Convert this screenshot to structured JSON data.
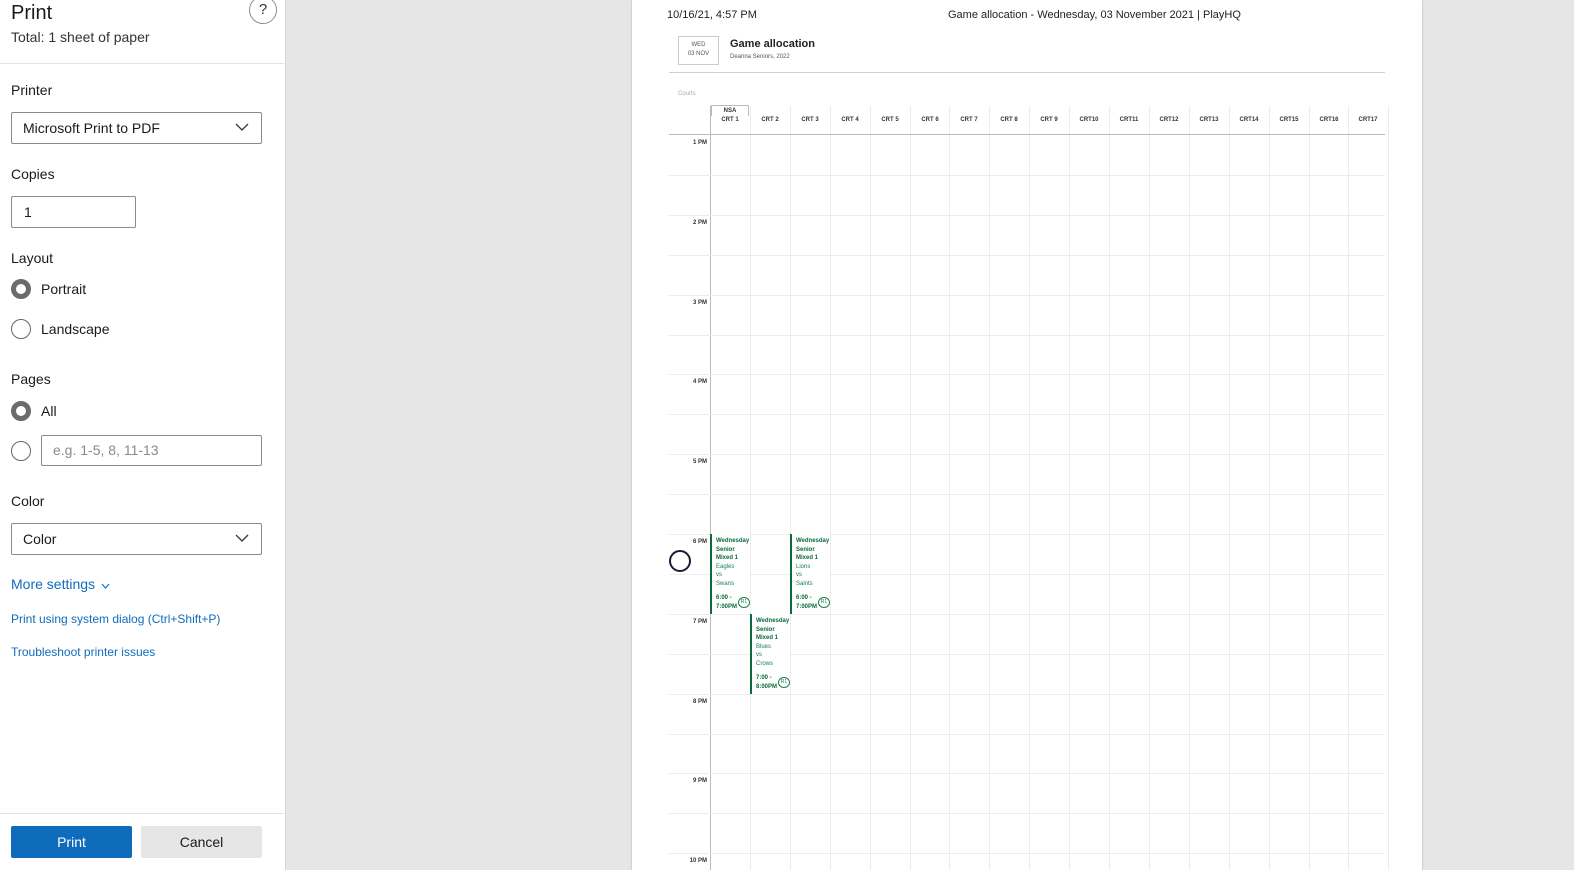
{
  "panel": {
    "title": "Print",
    "help": "?",
    "subtitle": "Total: 1 sheet of paper",
    "printer": {
      "label": "Printer",
      "value": "Microsoft Print to PDF"
    },
    "copies": {
      "label": "Copies",
      "value": "1"
    },
    "layout": {
      "label": "Layout",
      "options": [
        "Portrait",
        "Landscape"
      ],
      "selected": "Portrait"
    },
    "pages": {
      "label": "Pages",
      "all_label": "All",
      "range_placeholder": "e.g. 1-5, 8, 11-13",
      "selected": "All"
    },
    "color": {
      "label": "Color",
      "value": "Color"
    },
    "more_settings": "More settings",
    "system_dialog": "Print using system dialog (Ctrl+Shift+P)",
    "troubleshoot": "Troubleshoot printer issues",
    "print_button": "Print",
    "cancel_button": "Cancel",
    "accent_color": "#0f6cbd"
  },
  "preview": {
    "header_date": "10/16/21, 4:57 PM",
    "header_title": "Game allocation - Wednesday, 03 November 2021 | PlayHQ",
    "date_day": "WED",
    "date_date": "03 NOV",
    "page_title": "Game allocation",
    "page_subtitle": "Deanna Seniors, 2022",
    "courts_label": "Courts",
    "venue_label": "NSA",
    "courts": [
      "CRT 1",
      "CRT 2",
      "CRT 3",
      "CRT 4",
      "CRT 5",
      "CRT 6",
      "CRT 7",
      "CRT 8",
      "CRT 9",
      "CRT10",
      "CRT11",
      "CRT12",
      "CRT13",
      "CRT14",
      "CRT15",
      "CRT16",
      "CRT17"
    ],
    "times": [
      "1 PM",
      "2 PM",
      "3 PM",
      "4 PM",
      "5 PM",
      "6 PM",
      "7 PM",
      "8 PM",
      "9 PM",
      "10 PM"
    ],
    "games": [
      {
        "name": "Wednesday Senior Mixed 1",
        "home": "Eagles",
        "vs": "vs",
        "away": "Swans",
        "time": "6:00 - 7:00PM",
        "badge": "R1"
      },
      {
        "name": "Wednesday Senior Mixed 1",
        "home": "Lions",
        "vs": "vs",
        "away": "Saints",
        "time": "6:00 - 7:00PM",
        "badge": "R1"
      },
      {
        "name": "Wednesday Senior Mixed 1",
        "home": "Blues",
        "vs": "vs",
        "away": "Crows",
        "time": "7:00 - 8:00PM",
        "badge": "R1"
      }
    ],
    "game_color": "#0a6b3c"
  }
}
